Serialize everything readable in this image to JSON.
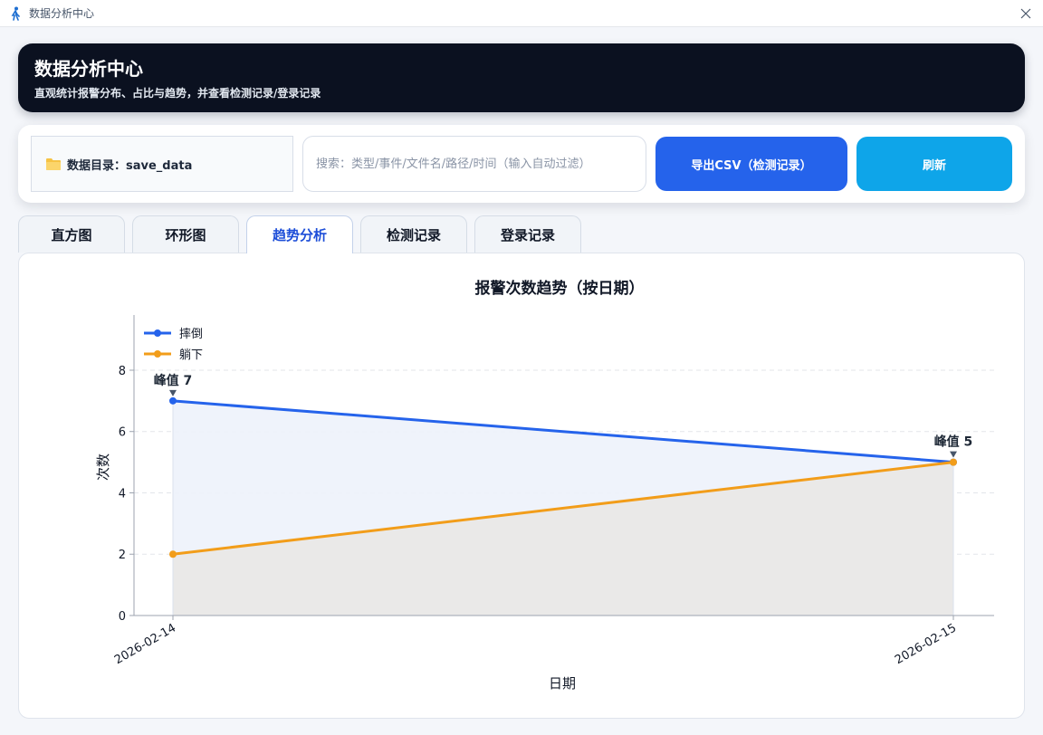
{
  "window": {
    "title": "数据分析中心",
    "close_icon": "close-icon",
    "app_icon": "person-walking-icon"
  },
  "header": {
    "title": "数据分析中心",
    "subtitle": "直观统计报警分布、占比与趋势，并查看检测记录/登录记录"
  },
  "toolbar": {
    "data_dir_label": "数据目录：save_data",
    "folder_icon": "folder-icon",
    "search_placeholder": "搜索：类型/事件/文件名/路径/时间（输入自动过滤）",
    "search_value": "",
    "export_label": "导出CSV（检测记录）",
    "refresh_label": "刷新",
    "colors": {
      "export": "#2563eb",
      "refresh": "#0ea5e9"
    }
  },
  "tabs": [
    {
      "label": "直方图",
      "active": false
    },
    {
      "label": "环形图",
      "active": false
    },
    {
      "label": "趋势分析",
      "active": true
    },
    {
      "label": "检测记录",
      "active": false
    },
    {
      "label": "登录记录",
      "active": false
    }
  ],
  "chart_data": {
    "type": "line",
    "title": "报警次数趋势（按日期）",
    "xlabel": "日期",
    "ylabel": "次数",
    "x": [
      "2026-02-14",
      "2026-02-15"
    ],
    "ylim": [
      0,
      9.8
    ],
    "yticks": [
      0,
      2,
      4,
      6,
      8
    ],
    "grid": true,
    "legend": "top-left",
    "series": [
      {
        "name": "摔倒",
        "values": [
          7,
          5
        ],
        "color": "#2563eb",
        "fill": "#edf2fb"
      },
      {
        "name": "躺下",
        "values": [
          2,
          5
        ],
        "color": "#f29d1a",
        "fill": "#e9e8e6"
      }
    ],
    "annotations": [
      {
        "text": "峰值 7",
        "x": "2026-02-14",
        "y": 7
      },
      {
        "text": "峰值 5",
        "x": "2026-02-15",
        "y": 5
      }
    ]
  }
}
